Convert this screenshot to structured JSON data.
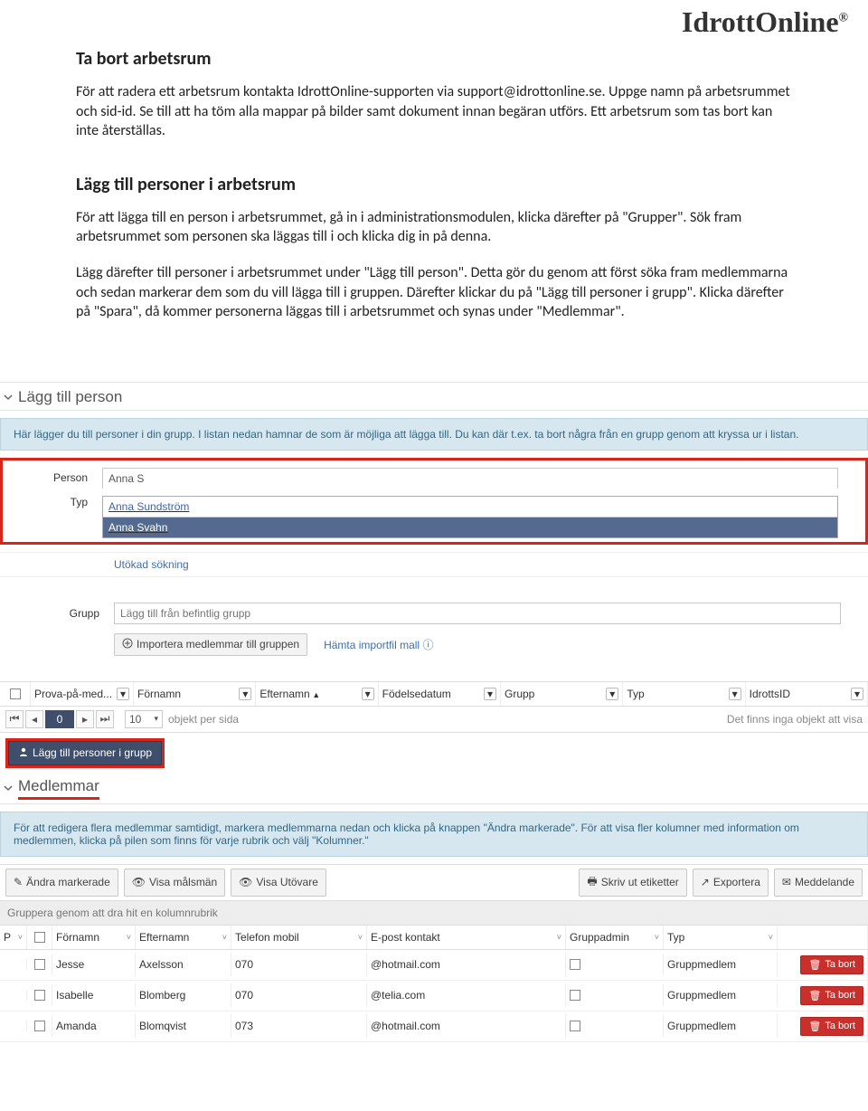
{
  "logo": "IdrottOnline",
  "doc": {
    "section1_title": "Ta bort arbetsrum",
    "section1_p": "För att radera ett arbetsrum kontakta IdrottOnline-supporten via support@idrottonline.se. Uppge namn på arbetsrummet och sid-id. Se till att ha töm alla mappar på bilder samt dokument innan begäran utförs. Ett arbetsrum som tas bort kan inte återställas.",
    "section2_title": "Lägg till personer i arbetsrum",
    "section2_p1": "För att lägga till en person i arbetsrummet, gå in i administrationsmodulen, klicka därefter på \"Grupper\". Sök fram arbetsrummet som personen ska läggas till i och klicka dig in på denna.",
    "section2_p2": "Lägg därefter till personer i arbetsrummet under \"Lägg till person\". Detta gör du genom att först söka fram medlemmarna och sedan markerar dem som du vill lägga till i gruppen. Därefter klickar du på \"Lägg till personer i grupp\". Klicka därefter på \"Spara\", då kommer personerna läggas till i arbetsrummet och synas under \"Medlemmar\"."
  },
  "addPerson": {
    "title": "Lägg till person",
    "banner": "Här lägger du till personer i din grupp. I listan nedan hamnar de som är möjliga att lägga till. Du kan där t.ex. ta bort några från en grupp genom att kryssa ur i listan.",
    "label_person": "Person",
    "label_typ": "Typ",
    "input_value": "Anna S",
    "ac": [
      {
        "text": "Anna Sundström",
        "selected": false
      },
      {
        "text": "Anna Svahn",
        "selected": true
      }
    ],
    "extended_search": "Utökad sökning",
    "label_grupp": "Grupp",
    "grupp_placeholder": "Lägg till från befintlig grupp",
    "import_btn": "Importera medlemmar till gruppen",
    "download_template": "Hämta importfil mall"
  },
  "emptyGrid": {
    "headers": [
      "Prova-på-med...",
      "Förnamn",
      "Efternamn",
      "Födelsedatum",
      "Grupp",
      "Typ",
      "IdrottsID"
    ],
    "sort_col": "Efternamn",
    "pager_page": "0",
    "per_page": "10",
    "per_page_label": "objekt per sida",
    "empty_msg": "Det finns inga objekt att visa",
    "add_btn": "Lägg till personer i grupp"
  },
  "members": {
    "title": "Medlemmar",
    "banner": "För att redigera flera medlemmar samtidigt, markera medlemmarna nedan och klicka på knappen \"Ändra markerade\". För att visa fler kolumner med information om medlemmen, klicka på pilen som finns för varje rubrik och välj \"Kolumner.\"",
    "toolbar": {
      "edit": "Ändra markerade",
      "show_malsman": "Visa målsmän",
      "show_utovare": "Visa Utövare",
      "print": "Skriv ut etiketter",
      "export": "Exportera",
      "message": "Meddelande"
    },
    "group_hint": "Gruppera genom att dra hit en kolumnrubrik",
    "headers": {
      "p": "P",
      "fornamn": "Förnamn",
      "efternamn": "Efternamn",
      "tel": "Telefon mobil",
      "epost": "E-post kontakt",
      "gadmin": "Gruppadmin",
      "typ": "Typ"
    },
    "rows": [
      {
        "fornamn": "Jesse",
        "efternamn": "Axelsson",
        "tel": "070",
        "epost": "@hotmail.com",
        "typ": "Gruppmedlem",
        "del": "Ta bort"
      },
      {
        "fornamn": "Isabelle",
        "efternamn": "Blomberg",
        "tel": "070",
        "epost": "@telia.com",
        "typ": "Gruppmedlem",
        "del": "Ta bort"
      },
      {
        "fornamn": "Amanda",
        "efternamn": "Blomqvist",
        "tel": "073",
        "epost": "@hotmail.com",
        "typ": "Gruppmedlem",
        "del": "Ta bort"
      }
    ]
  }
}
